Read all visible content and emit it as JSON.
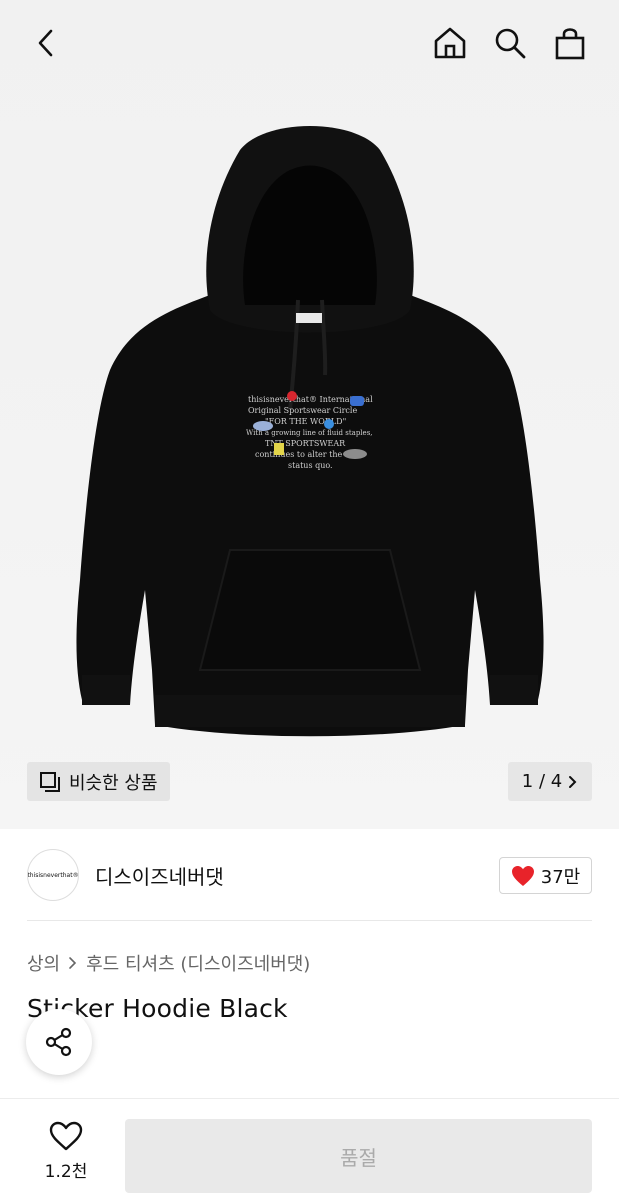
{
  "product_image": {
    "embroidery_lines": [
      "thisisneverthat® International",
      "Original Sportswear Circle",
      "\"FOR THE WORLD\"",
      "With a growing line of fluid staples,",
      "TNT SPORTSWEAR",
      "continues to alter the",
      "status quo."
    ],
    "similar_label": "비슷한 상품",
    "pager_text": "1 / 4"
  },
  "brand": {
    "logo_text": "thisisneverthat®",
    "name": "디스이즈네버댓",
    "like_count": "37만",
    "heart_color": "#e8232a"
  },
  "breadcrumb": {
    "level1": "상의",
    "level2": "후드 티셔츠 (디스이즈네버댓)"
  },
  "product": {
    "title": "Sticker Hoodie Black"
  },
  "bottom_bar": {
    "wish_count": "1.2천",
    "buy_label": "품절"
  }
}
